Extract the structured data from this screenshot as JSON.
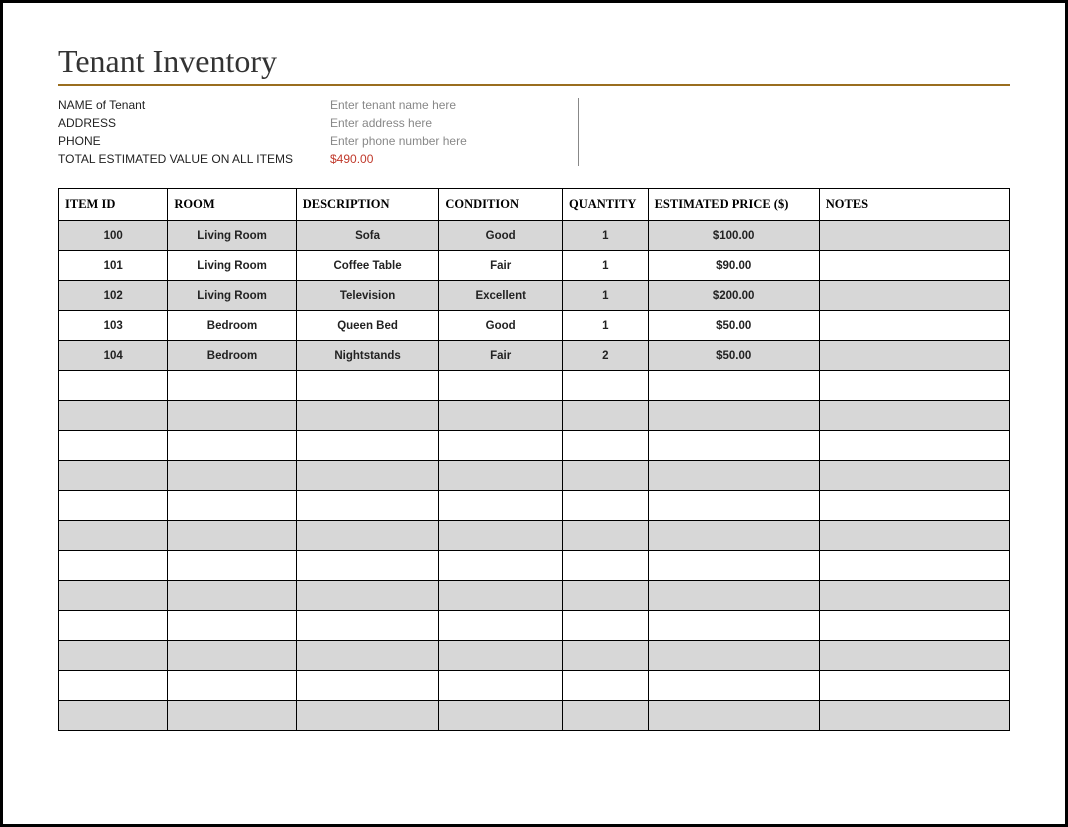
{
  "title": "Tenant Inventory",
  "meta": {
    "name_label": "NAME of Tenant",
    "name_value": "Enter tenant name here",
    "address_label": "ADDRESS",
    "address_value": "Enter address here",
    "phone_label": "PHONE",
    "phone_value": "Enter phone number here",
    "total_label": "TOTAL ESTIMATED VALUE ON ALL ITEMS",
    "total_value": "$490.00"
  },
  "columns": {
    "item_id": "ITEM ID",
    "room": "ROOM",
    "description": "DESCRIPTION",
    "condition": "CONDITION",
    "quantity": "QUANTITY",
    "estimated_price": "ESTIMATED PRICE ($)",
    "notes": "NOTES"
  },
  "rows": [
    {
      "item_id": "100",
      "room": "Living Room",
      "description": "Sofa",
      "condition": "Good",
      "quantity": "1",
      "estimated_price": "$100.00",
      "notes": ""
    },
    {
      "item_id": "101",
      "room": "Living Room",
      "description": "Coffee Table",
      "condition": "Fair",
      "quantity": "1",
      "estimated_price": "$90.00",
      "notes": ""
    },
    {
      "item_id": "102",
      "room": "Living Room",
      "description": "Television",
      "condition": "Excellent",
      "quantity": "1",
      "estimated_price": "$200.00",
      "notes": ""
    },
    {
      "item_id": "103",
      "room": "Bedroom",
      "description": "Queen Bed",
      "condition": "Good",
      "quantity": "1",
      "estimated_price": "$50.00",
      "notes": ""
    },
    {
      "item_id": "104",
      "room": "Bedroom",
      "description": "Nightstands",
      "condition": "Fair",
      "quantity": "2",
      "estimated_price": "$50.00",
      "notes": ""
    },
    {
      "item_id": "",
      "room": "",
      "description": "",
      "condition": "",
      "quantity": "",
      "estimated_price": "",
      "notes": ""
    },
    {
      "item_id": "",
      "room": "",
      "description": "",
      "condition": "",
      "quantity": "",
      "estimated_price": "",
      "notes": ""
    },
    {
      "item_id": "",
      "room": "",
      "description": "",
      "condition": "",
      "quantity": "",
      "estimated_price": "",
      "notes": ""
    },
    {
      "item_id": "",
      "room": "",
      "description": "",
      "condition": "",
      "quantity": "",
      "estimated_price": "",
      "notes": ""
    },
    {
      "item_id": "",
      "room": "",
      "description": "",
      "condition": "",
      "quantity": "",
      "estimated_price": "",
      "notes": ""
    },
    {
      "item_id": "",
      "room": "",
      "description": "",
      "condition": "",
      "quantity": "",
      "estimated_price": "",
      "notes": ""
    },
    {
      "item_id": "",
      "room": "",
      "description": "",
      "condition": "",
      "quantity": "",
      "estimated_price": "",
      "notes": ""
    },
    {
      "item_id": "",
      "room": "",
      "description": "",
      "condition": "",
      "quantity": "",
      "estimated_price": "",
      "notes": ""
    },
    {
      "item_id": "",
      "room": "",
      "description": "",
      "condition": "",
      "quantity": "",
      "estimated_price": "",
      "notes": ""
    },
    {
      "item_id": "",
      "room": "",
      "description": "",
      "condition": "",
      "quantity": "",
      "estimated_price": "",
      "notes": ""
    },
    {
      "item_id": "",
      "room": "",
      "description": "",
      "condition": "",
      "quantity": "",
      "estimated_price": "",
      "notes": ""
    },
    {
      "item_id": "",
      "room": "",
      "description": "",
      "condition": "",
      "quantity": "",
      "estimated_price": "",
      "notes": ""
    }
  ]
}
